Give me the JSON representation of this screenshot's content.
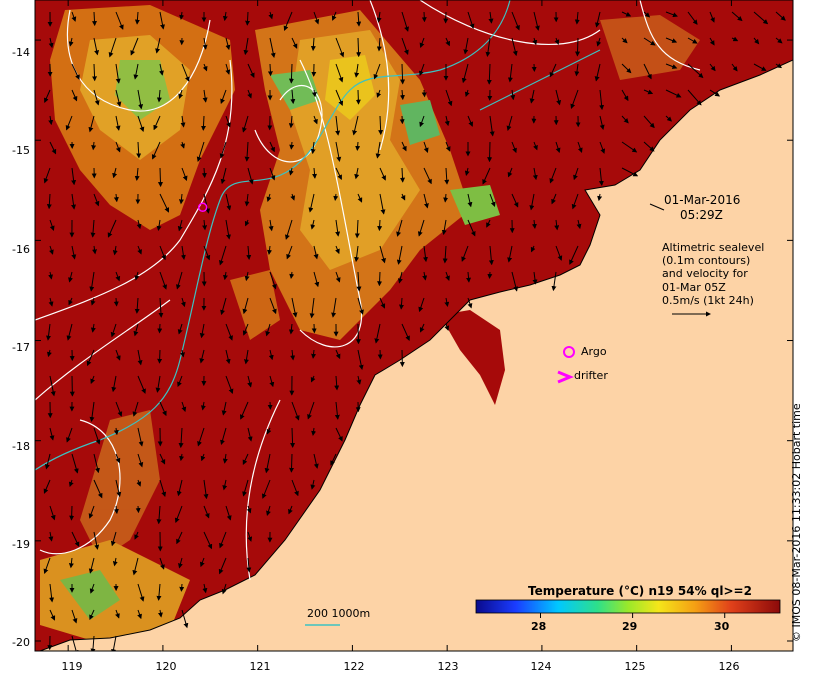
{
  "map": {
    "lat_ticks": [
      "-14",
      "-15",
      "-16",
      "-17",
      "-18",
      "-19",
      "-20"
    ],
    "lon_ticks": [
      "119",
      "120",
      "121",
      "122",
      "123",
      "124",
      "125",
      "126"
    ],
    "lat_range": [
      -20.1,
      -13.6
    ],
    "lon_range": [
      118.65,
      126.65
    ],
    "date_label": "01-Mar-2016",
    "time_label": "05:29Z",
    "altimetry_lines": [
      "Altimetric sealevel",
      "(0.1m contours)",
      "and velocity for",
      "01-Mar 05Z",
      "0.5m/s (1kt 24h)"
    ],
    "legend_argo": "Argo",
    "legend_drifter": "drifter",
    "isobath_label": "200  1000m",
    "colorbar_title": "Temperature (°C) n19 54% ql>=2",
    "colorbar_ticks": [
      "28",
      "29",
      "30"
    ],
    "colorbar_range": [
      27.3,
      30.6
    ],
    "credit": "© IMOS 08-Mar-2016 11:33:02 Hobart time",
    "argo_float": {
      "lon": 120.42,
      "lat": -15.67
    },
    "colors": {
      "warm_sea": "#a60a0a",
      "land": "#fdd3a6",
      "isobath": "#3cc2c2",
      "contour": "#ffffff",
      "argo": "#ff00ff",
      "vector": "#000000"
    }
  }
}
